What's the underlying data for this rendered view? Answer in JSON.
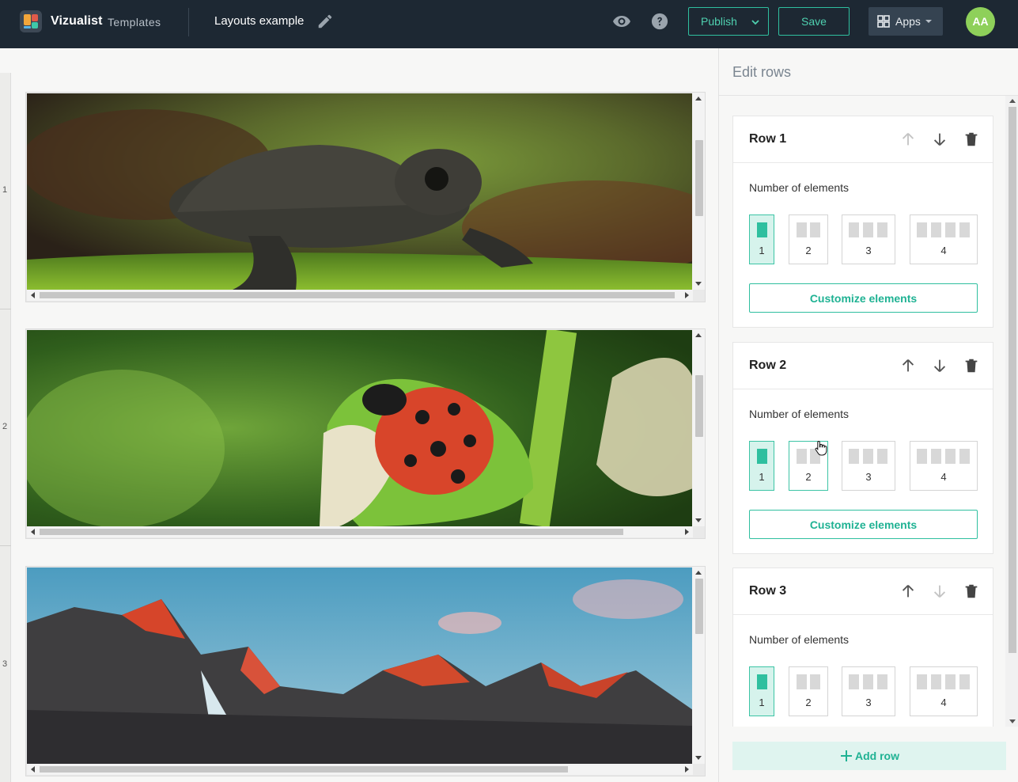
{
  "header": {
    "brand": "Vizualist",
    "brand_sub": "Templates",
    "doc_title": "Layouts example",
    "publish_label": "Publish",
    "save_label": "Save",
    "apps_label": "Apps",
    "avatar_initials": "AA"
  },
  "canvas": {
    "rows": [
      {
        "number": "1",
        "image": "turtle-photo"
      },
      {
        "number": "2",
        "image": "ladybug-photo"
      },
      {
        "number": "3",
        "image": "mountains-photo"
      }
    ]
  },
  "panel": {
    "title": "Edit rows",
    "noe_label": "Number of elements",
    "customize_label": "Customize elements",
    "option_labels": [
      "1",
      "2",
      "3",
      "4"
    ],
    "rows": [
      {
        "title": "Row 1",
        "selected": "1"
      },
      {
        "title": "Row 2",
        "selected": "1"
      },
      {
        "title": "Row 3",
        "selected": "1"
      }
    ],
    "add_row_label": "Add row"
  },
  "colors": {
    "topbar": "#1d2833",
    "accent": "#2fbf9f",
    "avatar": "#8ed05a",
    "selected_bg": "#d6f3ec"
  }
}
